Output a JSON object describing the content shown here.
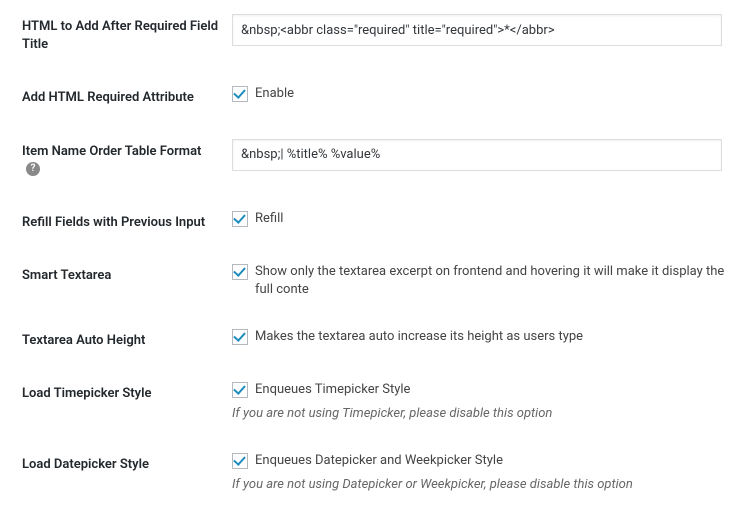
{
  "fields": {
    "html_after_required": {
      "label": "HTML to Add After Required Field Title",
      "value": "&nbsp;<abbr class=\"required\" title=\"required\">*</abbr>"
    },
    "add_html_required_attr": {
      "label": "Add HTML Required Attribute",
      "checkbox_label": "Enable"
    },
    "item_name_order": {
      "label": "Item Name Order Table Format",
      "value": "&nbsp;| %title% %value%"
    },
    "refill_fields": {
      "label": "Refill Fields with Previous Input",
      "checkbox_label": "Refill"
    },
    "smart_textarea": {
      "label": "Smart Textarea",
      "checkbox_label": "Show only the textarea excerpt on frontend and hovering it will make it display the full conte"
    },
    "textarea_auto_height": {
      "label": "Textarea Auto Height",
      "checkbox_label": "Makes the textarea auto increase its height as users type"
    },
    "load_timepicker": {
      "label": "Load Timepicker Style",
      "checkbox_label": "Enqueues Timepicker Style",
      "description": "If you are not using Timepicker, please disable this option"
    },
    "load_datepicker": {
      "label": "Load Datepicker Style",
      "checkbox_label": "Enqueues Datepicker and Weekpicker Style",
      "description": "If you are not using Datepicker or Weekpicker, please disable this option"
    }
  }
}
